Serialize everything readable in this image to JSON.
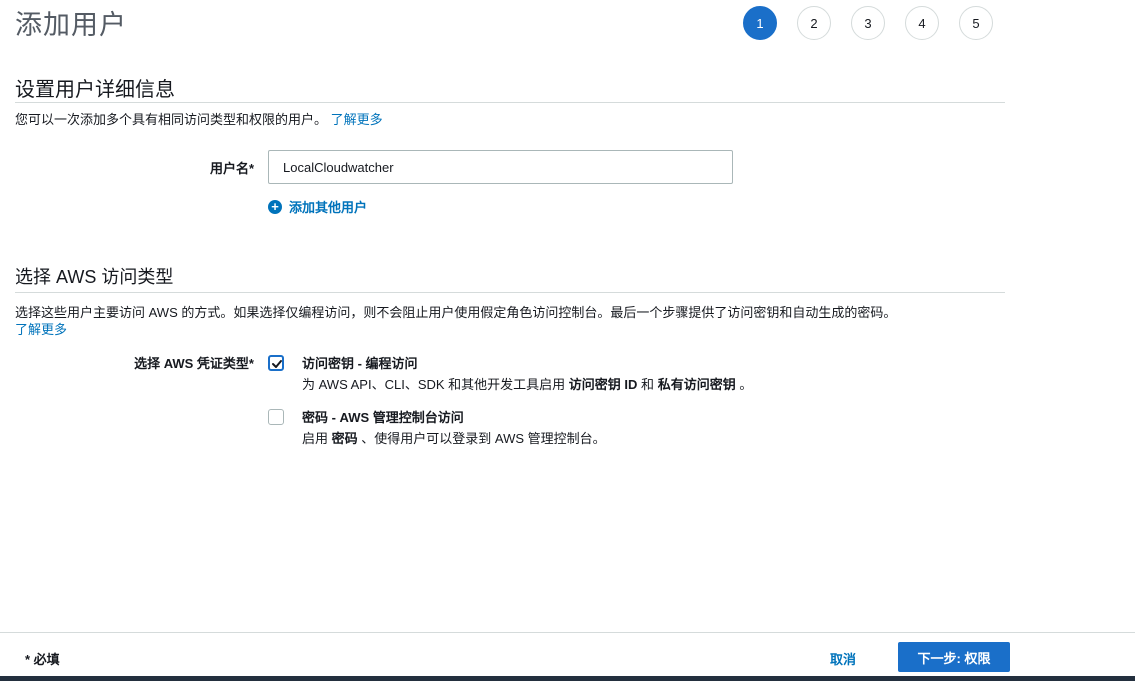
{
  "page": {
    "title": "添加用户"
  },
  "steps": [
    "1",
    "2",
    "3",
    "4",
    "5"
  ],
  "section1": {
    "title": "设置用户详细信息",
    "desc": "您可以一次添加多个具有相同访问类型和权限的用户。",
    "learn_more": "了解更多"
  },
  "username": {
    "label": "用户名*",
    "value": "LocalCloudwatcher"
  },
  "add_user": {
    "label": "添加其他用户"
  },
  "section2": {
    "title": "选择 AWS 访问类型",
    "desc": "选择这些用户主要访问 AWS 的方式。如果选择仅编程访问，则不会阻止用户使用假定角色访问控制台。最后一个步骤提供了访问密钥和自动生成的密码。",
    "learn_more": "了解更多"
  },
  "credential": {
    "label": "选择 AWS 凭证类型*",
    "options": [
      {
        "title": "访问密钥 - 编程访问",
        "desc_prefix": "为 AWS API、CLI、SDK 和其他开发工具启用",
        "desc_b1": "访问密钥 ID",
        "desc_mid": "和",
        "desc_b2": "私有访问密钥",
        "desc_suffix": "。",
        "checked": true
      },
      {
        "title": "密码 - AWS 管理控制台访问",
        "desc_prefix": "启用",
        "desc_b1": "密码",
        "desc_suffix": "、使得用户可以登录到 AWS 管理控制台。",
        "checked": false
      }
    ]
  },
  "footer": {
    "required": "* 必填",
    "cancel": "取消",
    "next": "下一步: 权限"
  },
  "colors": {
    "primary": "#1a6fc9",
    "link": "#0073bb",
    "footer_bar": "#232f3e"
  }
}
